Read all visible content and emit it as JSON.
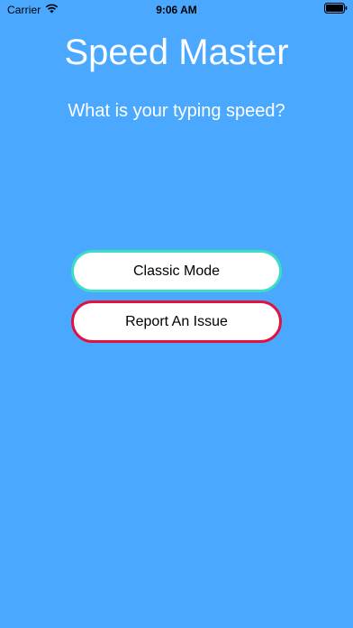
{
  "status_bar": {
    "carrier": "Carrier",
    "time": "9:06 AM",
    "wifi_icon": "wifi-icon",
    "battery_icon": "battery-icon"
  },
  "header": {
    "title": "Speed Master",
    "subtitle": "What is your typing speed?"
  },
  "menu": {
    "classic_label": "Classic Mode",
    "report_label": "Report An Issue"
  },
  "colors": {
    "background": "#4AA8FF",
    "classic_border": "#3DDCC4",
    "report_border": "#E0133E"
  }
}
